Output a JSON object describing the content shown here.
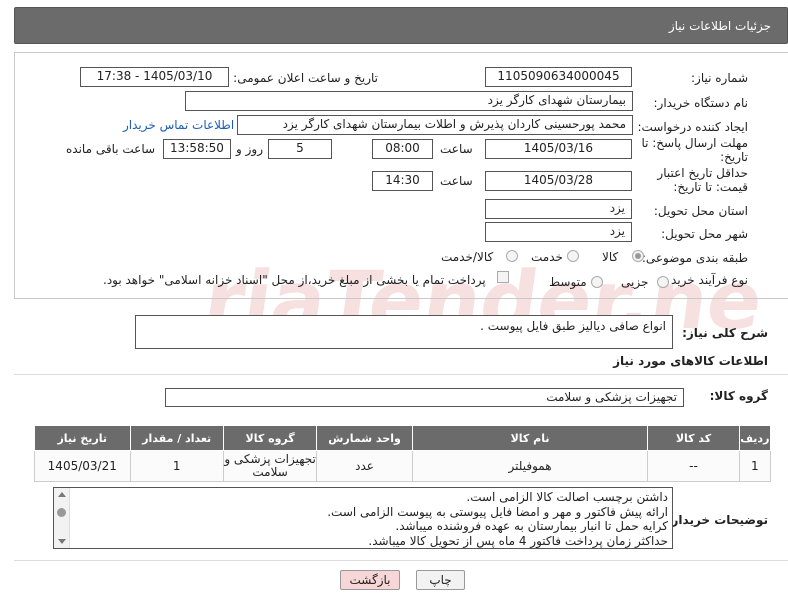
{
  "header": {
    "title": "جزئیات اطلاعات نیاز"
  },
  "fields": {
    "need_number_label": "شماره نیاز:",
    "need_number": "1105090634000045",
    "announce_label": "تاریخ و ساعت اعلان عمومی:",
    "announce_value": "1405/03/10 - 17:38",
    "buyer_label": "نام دستگاه خریدار:",
    "buyer_value": "بیمارستان شهدای کارگر یزد",
    "creator_label": "ایجاد کننده درخواست:",
    "creator_value": "محمد پورحسینی کاردان پذیرش و اطلات بیمارستان شهدای کارگر یزد",
    "contact_link": "اطلاعات تماس خریدار",
    "deadline_label": "مهلت ارسال پاسخ: تا تاریخ:",
    "deadline_date": "1405/03/16",
    "time_label": "ساعت",
    "deadline_time": "08:00",
    "days_value": "5",
    "days_label": "روز و",
    "remaining_time": "13:58:50",
    "remaining_label": "ساعت باقی مانده",
    "validity_label": "حداقل تاریخ اعتبار قیمت: تا تاریخ:",
    "validity_date": "1405/03/28",
    "validity_time": "14:30",
    "province_label": "استان محل تحویل:",
    "province_value": "یزد",
    "city_label": "شهر محل تحویل:",
    "city_value": "یزد",
    "category_label": "طبقه بندی موضوعی:",
    "category_options": [
      "کالا",
      "خدمت",
      "کالا/خدمت"
    ],
    "category_selected": "کالا",
    "process_label": "نوع فرآیند خرید :",
    "process_options": [
      "جزیی",
      "متوسط"
    ],
    "process_note": "پرداخت تمام یا بخشی از مبلغ خرید،از محل \"اسناد خزانه اسلامی\" خواهد بود."
  },
  "description": {
    "label": "شرح کلی نیاز:",
    "value": "انواع صافی دیالیز طبق فایل پیوست ."
  },
  "goods_section": {
    "title": "اطلاعات کالاهای مورد نیاز",
    "group_label": "گروه کالا:",
    "group_value": "تجهیزات پزشکی و سلامت"
  },
  "table": {
    "headers": [
      "ردیف",
      "کد کالا",
      "نام کالا",
      "واحد شمارش",
      "گروه کالا",
      "تعداد / مقدار",
      "تاریخ نیاز"
    ],
    "rows": [
      [
        "1",
        "--",
        "هموفیلتر",
        "عدد",
        "تجهیزات پزشکی و سلامت",
        "1",
        "1405/03/21"
      ]
    ]
  },
  "buyer_notes": {
    "label": "توضیحات خریدار:",
    "lines": [
      "داشتن برچسب اصالت کالا الزامی است.",
      "ارائه پیش فاکتور و مهر و امضا فایل پیوستی به پیوست الزامی است.",
      "کرایه حمل تا انبار بیمارستان به عهده فروشنده میباشد.",
      "حداکثر زمان پرداخت فاکتور 4 ماه پس از تحویل کالا میباشد."
    ]
  },
  "buttons": {
    "print": "چاپ",
    "back": "بازگشت"
  },
  "watermark": "AriaTender.net",
  "colors": {
    "header_bg": "#6b6b6b",
    "link": "#1a5fb4",
    "back_button": "#f6d6d6",
    "print_button": "#f2f2f2"
  }
}
